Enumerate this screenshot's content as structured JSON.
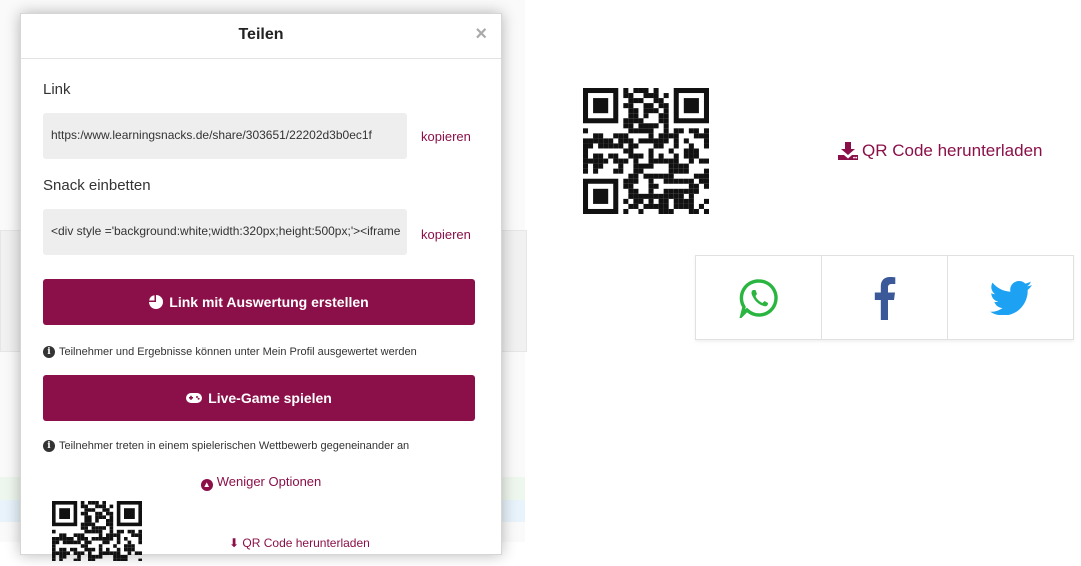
{
  "modal": {
    "title": "Teilen",
    "close_icon": "×",
    "link_label": "Link",
    "link_value": "https:/www.learningsnacks.de/share/303651/22202d3b0ec1f",
    "copy_label": "kopieren",
    "embed_label": "Snack einbetten",
    "embed_value": "<div style ='background:white;width:320px;height:500px;'><iframe",
    "analysis_button": "Link mit Auswertung erstellen",
    "analysis_info": "Teilnehmer und Ergebnisse können unter Mein Profil ausgewertet werden",
    "live_button": "Live-Game spielen",
    "live_info": "Teilnehmer treten in einem spielerischen Wettbewerb gegeneinander an",
    "less_options": "Weniger Optionen",
    "small_download": "QR Code herunterladen"
  },
  "right": {
    "download_label": "QR Code herunterladen",
    "share_icons": [
      "whatsapp-icon",
      "facebook-icon",
      "twitter-icon"
    ]
  },
  "colors": {
    "accent": "#8b1049",
    "whatsapp": "#2ab540",
    "facebook": "#3b5998",
    "twitter": "#1da1f2"
  }
}
